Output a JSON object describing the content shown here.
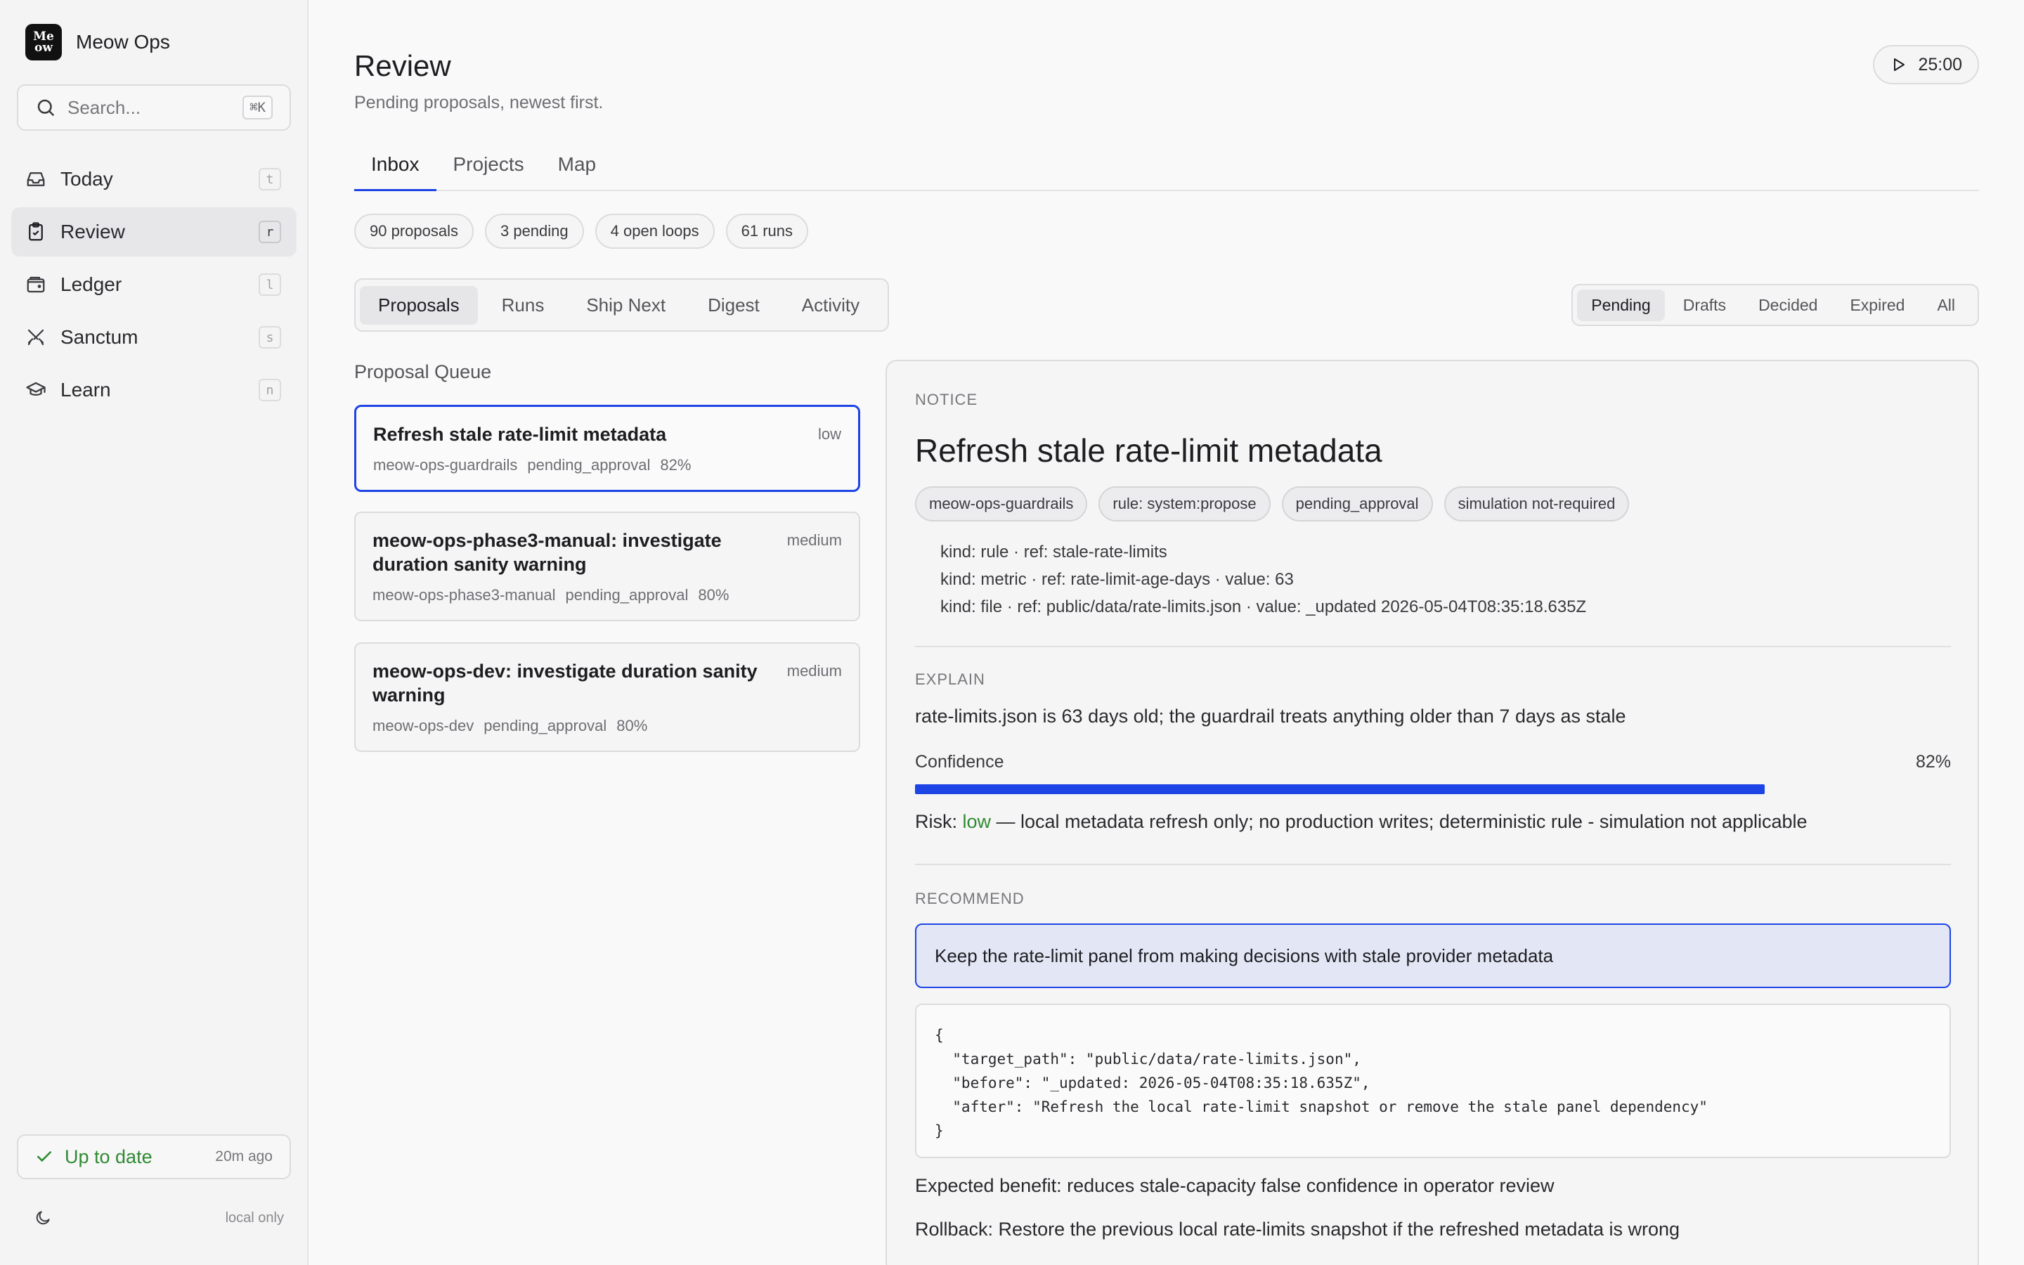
{
  "app": {
    "name": "Meow Ops",
    "logo_line1": "Me",
    "logo_line2": "ow"
  },
  "search": {
    "placeholder": "Search...",
    "shortcut": "⌘K"
  },
  "nav": {
    "items": [
      {
        "label": "Today",
        "key": "t",
        "icon": "inbox-icon"
      },
      {
        "label": "Review",
        "key": "r",
        "icon": "clipboard-icon"
      },
      {
        "label": "Ledger",
        "key": "l",
        "icon": "wallet-icon"
      },
      {
        "label": "Sanctum",
        "key": "s",
        "icon": "swords-icon"
      },
      {
        "label": "Learn",
        "key": "n",
        "icon": "graduation-cap-icon"
      }
    ],
    "active": "Review"
  },
  "sync": {
    "status": "Up to date",
    "time": "20m ago"
  },
  "footer": {
    "mode": "local only"
  },
  "page": {
    "title": "Review",
    "subtitle": "Pending proposals, newest first.",
    "timer": "25:00"
  },
  "tabs": [
    "Inbox",
    "Projects",
    "Map"
  ],
  "stats": [
    "90 proposals",
    "3 pending",
    "4 open loops",
    "61 runs"
  ],
  "views": [
    "Proposals",
    "Runs",
    "Ship Next",
    "Digest",
    "Activity"
  ],
  "filters": [
    "Pending",
    "Drafts",
    "Decided",
    "Expired",
    "All"
  ],
  "queue": {
    "heading": "Proposal Queue",
    "items": [
      {
        "title": "Refresh stale rate-limit metadata",
        "risk": "low",
        "project": "meow-ops-guardrails",
        "status": "pending_approval",
        "confidence": "82%"
      },
      {
        "title": "meow-ops-phase3-manual: investigate duration sanity warning",
        "risk": "medium",
        "project": "meow-ops-phase3-manual",
        "status": "pending_approval",
        "confidence": "80%"
      },
      {
        "title": "meow-ops-dev: investigate duration sanity warning",
        "risk": "medium",
        "project": "meow-ops-dev",
        "status": "pending_approval",
        "confidence": "80%"
      }
    ]
  },
  "detail": {
    "notice_label": "NOTICE",
    "title": "Refresh stale rate-limit metadata",
    "tags": [
      "meow-ops-guardrails",
      "rule: system:propose",
      "pending_approval",
      "simulation not-required"
    ],
    "refs": [
      "kind: rule · ref: stale-rate-limits",
      "kind: metric · ref: rate-limit-age-days · value: 63",
      "kind: file · ref: public/data/rate-limits.json · value: _updated 2026-05-04T08:35:18.635Z"
    ],
    "explain_label": "EXPLAIN",
    "explain": "rate-limits.json is 63 days old; the guardrail treats anything older than 7 days as stale",
    "confidence_label": "Confidence",
    "confidence_text": "82%",
    "confidence_value": 0.82,
    "risk_prefix": "Risk: ",
    "risk_level": "low",
    "risk_detail": " — local metadata refresh only; no production writes; deterministic rule - simulation not applicable",
    "recommend_label": "RECOMMEND",
    "recommendation": "Keep the rate-limit panel from making decisions with stale provider metadata",
    "code": "{\n  \"target_path\": \"public/data/rate-limits.json\",\n  \"before\": \"_updated: 2026-05-04T08:35:18.635Z\",\n  \"after\": \"Refresh the local rate-limit snapshot or remove the stale panel dependency\"\n}",
    "benefit": "Expected benefit: reduces stale-capacity false confidence in operator review",
    "rollback": "Rollback: Restore the previous local rate-limits snapshot if the refreshed metadata is wrong"
  },
  "colors": {
    "accent": "#1d44e4",
    "success": "#2f8a33"
  }
}
